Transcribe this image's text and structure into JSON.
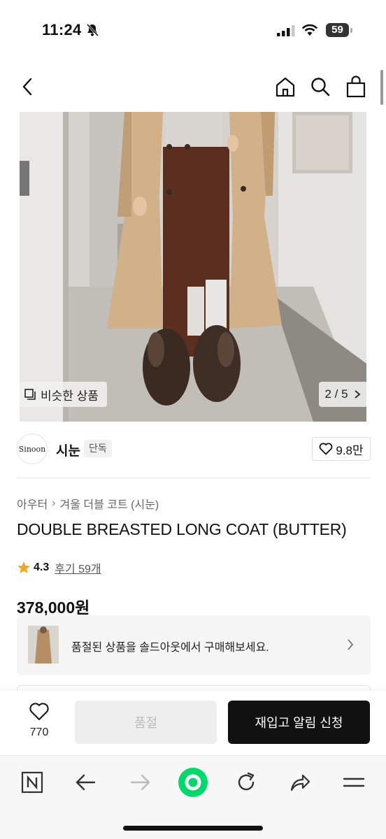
{
  "status_bar": {
    "time": "11:24",
    "battery": "59"
  },
  "top_nav": {
    "icons": [
      "back-icon",
      "home-icon",
      "search-icon",
      "bag-icon"
    ]
  },
  "image": {
    "similar_label": "비슷한 상품",
    "pager": "2 / 5"
  },
  "brand": {
    "logo_text": "Sinoon",
    "name": "시눈",
    "badge": "단독",
    "likes": "9.8만"
  },
  "product": {
    "breadcrumb": [
      "아우터",
      "겨울 더블 코트 (시눈)"
    ],
    "title": "DOUBLE BREASTED LONG COAT (BUTTER)",
    "rating": "4.3",
    "reviews": "후기 59개",
    "price": "378,000원"
  },
  "soldout_banner": {
    "text": "품절된 상품을 솔드아웃에서 구매해보세요."
  },
  "action_bar": {
    "wish_count": "770",
    "soldout_label": "품절",
    "restock_label": "재입고 알림 신청"
  },
  "browser_toolbar": {
    "icons": [
      "naver-icon",
      "back-arrow-icon",
      "forward-arrow-icon",
      "green-dot-icon",
      "refresh-icon",
      "share-icon",
      "menu-icon"
    ]
  },
  "colors": {
    "accent": "#111111",
    "star": "#f5a623",
    "green": "#03d96b",
    "coat": "#d2b088"
  }
}
